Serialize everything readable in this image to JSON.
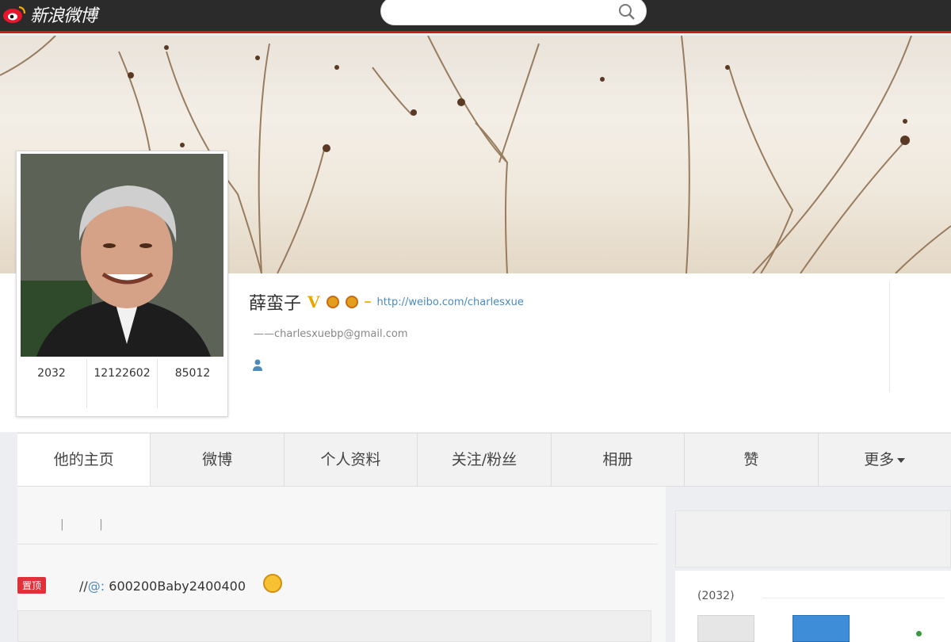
{
  "header": {
    "logo_text": "新浪微博",
    "search_placeholder": ""
  },
  "profile": {
    "name": "薛蛮子",
    "verified_badge": "V",
    "vip_label": "",
    "url": "http://weibo.com/charlesxue",
    "email": "——charlesxuebp@gmail.com",
    "stats": [
      "2032",
      "12122602",
      "85012"
    ]
  },
  "tabs": [
    {
      "label": "他的主页",
      "active": true
    },
    {
      "label": "微博"
    },
    {
      "label": "个人资料"
    },
    {
      "label": "关注/粉丝"
    },
    {
      "label": "相册"
    },
    {
      "label": "赞"
    },
    {
      "label": "更多"
    }
  ],
  "feed": {
    "filter": "| |",
    "top_tag": "置顶",
    "post_prefix": "//",
    "post_mention": "@:",
    "post_text": "600200Baby2400400",
    "emoji_icon": "laughing-face-icon",
    "repost_name": ""
  },
  "sidebar": {
    "follow_count": "(2032)"
  },
  "colors": {
    "topbar": "#2b2b2b",
    "accent_red": "#c71d1d",
    "link": "#4b8bbd",
    "top_tag": "#e0303a"
  }
}
